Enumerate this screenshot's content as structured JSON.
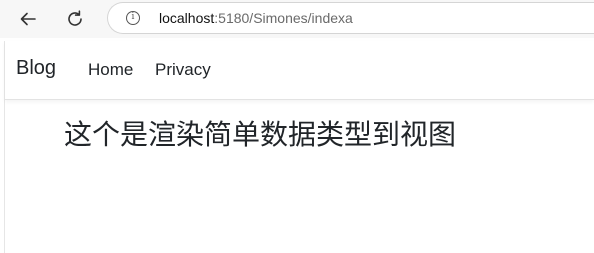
{
  "browser": {
    "url_host": "localhost",
    "url_path": ":5180/Simones/indexa",
    "info_glyph": "i",
    "icons": [
      "back-arrow-icon",
      "reload-icon",
      "info-icon"
    ]
  },
  "site_nav": {
    "brand": "Blog",
    "links": [
      {
        "label": "Home"
      },
      {
        "label": "Privacy"
      }
    ]
  },
  "main": {
    "heading": "这个是渲染简单数据类型到视图"
  }
}
